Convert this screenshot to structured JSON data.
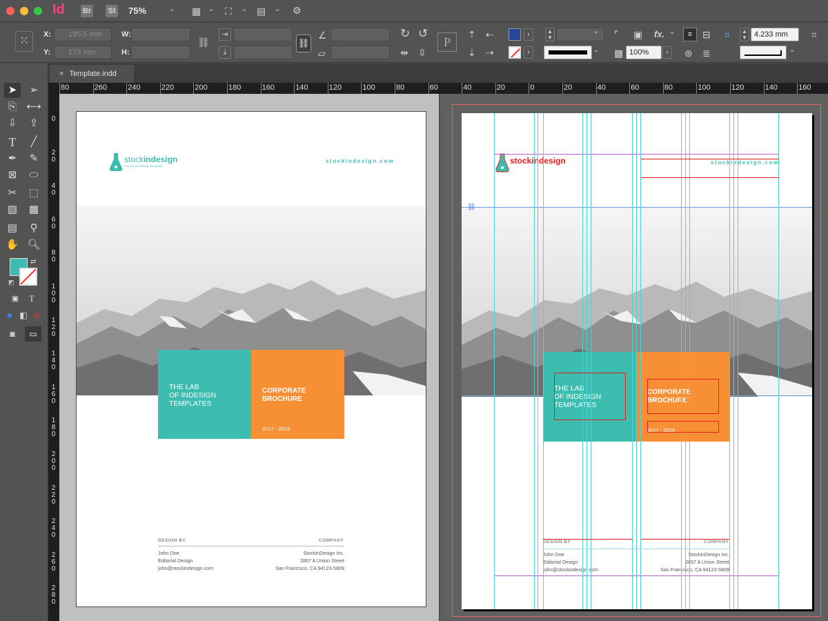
{
  "app": {
    "logo": "Id",
    "bridge_button": "Br",
    "stock_button": "St",
    "zoom_level": "75%"
  },
  "control_panel": {
    "x_label": "X:",
    "y_label": "Y:",
    "w_label": "W:",
    "h_label": "H:",
    "x_value": "195.5 mm",
    "y_value": "173 mm",
    "opacity_value": "100%",
    "stroke_weight_value": "4.233 mm",
    "fx_label": "fx.",
    "fill_color": "#26469c",
    "stroke_color": "#ff2b2b"
  },
  "document_tab": {
    "close_glyph": "×",
    "title": "Template.indd"
  },
  "rulers": {
    "horizontal": [
      "80",
      "260",
      "240",
      "220",
      "200",
      "180",
      "160",
      "140",
      "120",
      "100",
      "80",
      "60",
      "40",
      "20",
      "0",
      "20",
      "40",
      "60",
      "80",
      "100",
      "120",
      "140",
      "160",
      "1"
    ],
    "vertical": [
      "0",
      "20",
      "40",
      "60",
      "80",
      "100",
      "120",
      "140",
      "160",
      "180",
      "200",
      "220",
      "240",
      "260",
      "280"
    ]
  },
  "tools_panel": {
    "type_tool_glyph": "T",
    "fill_color": "#3dbdb0"
  },
  "brochure": {
    "logo_name_plain": "stock",
    "logo_name_bold": "indesign",
    "logo_tagline": "The Lab of InDesign Templates",
    "website": "stockindesign.com",
    "teal_text": "THE LAB\nOF INDESIGN\nTEMPLATES",
    "orange_title": "CORPORATE\nBROCHURE",
    "years": "2017 - 2019",
    "design_by_label": "DESIGN BY",
    "company_label": "COMPANY",
    "designer_info": "John Doe\nEditorial Design\njohn@stockindesign.com",
    "company_info": "StockinDesign Inc.\n2857 A Union Street\nSan Francisco, CA 94123-5809",
    "teal_color": "#3dbdb0",
    "orange_color": "#f78f35"
  }
}
